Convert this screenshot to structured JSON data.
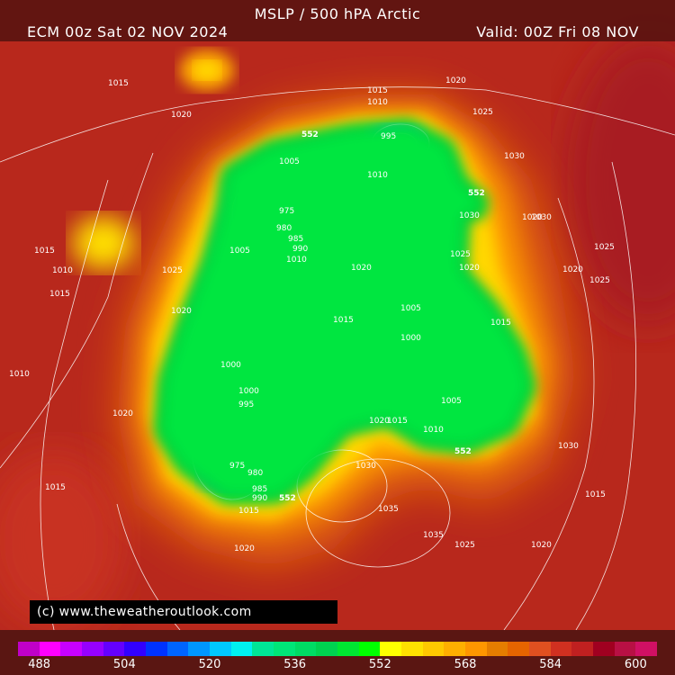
{
  "header": {
    "title": "MSLP / 500 hPA Arctic",
    "run": "ECM 00z Sat 02 NOV 2024",
    "valid": "Valid: 00Z Fri 08 NOV"
  },
  "credit": "(c) www.theweatheroutlook.com",
  "colorbar": {
    "unit_step": 4,
    "colors": [
      "#c000c8",
      "#ff00ff",
      "#c800ff",
      "#9600ff",
      "#6400ff",
      "#3200ff",
      "#0032ff",
      "#0064ff",
      "#0096ff",
      "#00c8ff",
      "#00f0f0",
      "#00e696",
      "#00e678",
      "#00dc64",
      "#00d250",
      "#00e632",
      "#00ff00",
      "#ffff00",
      "#ffe100",
      "#ffc800",
      "#ffaf00",
      "#ff9600",
      "#e67d00",
      "#e66400",
      "#e05020",
      "#d03020",
      "#c02020",
      "#a00020",
      "#b81044",
      "#d01064"
    ],
    "ticks": [
      "488",
      "504",
      "520",
      "536",
      "552",
      "568",
      "584",
      "600"
    ]
  },
  "contour_552_label": "552",
  "isobar_labels": [
    "1015",
    "1020",
    "1020",
    "1025",
    "1015",
    "1010",
    "995",
    "1010",
    "1005",
    "975",
    "980",
    "985",
    "990",
    "1005",
    "1010",
    "1020",
    "1015",
    "1030",
    "1030",
    "1020",
    "1025",
    "1020",
    "1025",
    "1015",
    "1010",
    "1015",
    "1020",
    "1000",
    "1000",
    "995",
    "975",
    "980",
    "985",
    "990",
    "1005",
    "1015",
    "1020",
    "1015",
    "1020",
    "1035",
    "1030",
    "1030",
    "1025",
    "1020",
    "1015",
    "1010",
    "1000",
    "1005",
    "1010",
    "1015",
    "1020",
    "1025",
    "1030",
    "1035",
    "1015",
    "1020",
    "1025",
    "552",
    "552",
    "552",
    "552"
  ]
}
